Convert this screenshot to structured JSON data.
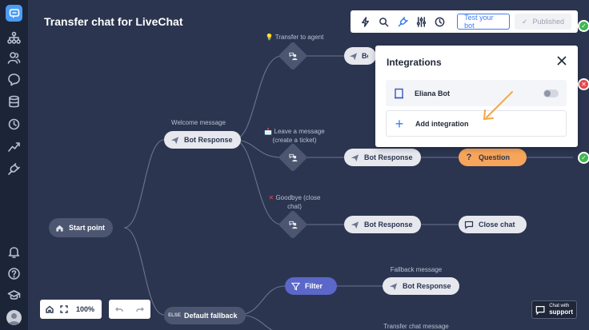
{
  "app": {
    "title": "Transfer chat for LiveChat"
  },
  "toolbar": {
    "test_label": "Test your bot",
    "published_label": "Published"
  },
  "nodes": {
    "start": "Start point",
    "welcome_label": "Welcome message",
    "bot_response": "Bot Response",
    "transfer_label": "Transfer to agent",
    "leave_label_1": "Leave a message",
    "leave_label_2": "(create a ticket)",
    "goodbye_label_1": "Goodbye (close",
    "goodbye_label_2": "chat)",
    "question": "Question",
    "close_chat": "Close chat",
    "fallback_label": "Fallback message",
    "filter": "Filter",
    "else_tag": "ELSE",
    "default_fallback": "Default fallback",
    "transfer_chat_label": "Transfer chat message"
  },
  "popup": {
    "title": "Integrations",
    "integration_name": "Eliana Bot",
    "add_label": "Add integration"
  },
  "zoom": {
    "level": "100%"
  },
  "support": {
    "line1": "Chat with",
    "line2": "support"
  },
  "colors": {
    "accent": "#3c7bf0",
    "question": "#f6a55a",
    "filter": "#5b67c9",
    "canvas": "#2b3550"
  },
  "icons": [
    "logo-icon",
    "flow-icon",
    "users-icon",
    "chat-icon",
    "database-icon",
    "history-icon",
    "reports-icon",
    "integrations-icon",
    "bell-icon",
    "help-icon",
    "academy-icon"
  ]
}
